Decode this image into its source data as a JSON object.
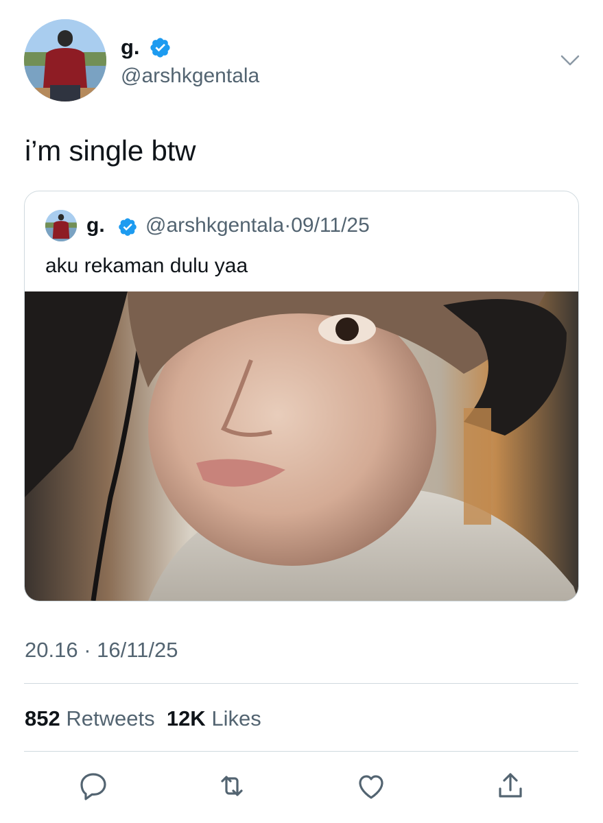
{
  "tweet": {
    "author": {
      "name": "g.",
      "handle": "@arshkgentala",
      "verified": true,
      "avatar": "person-from-behind-landscape"
    },
    "text": "i’m single btw",
    "menu_icon": "chevron-down-icon",
    "quoted": {
      "author_name": "g.",
      "meta": "@arshkgentala·09/11/25",
      "text": "aku rekaman dulu yaa",
      "photo": "selfie-with-headphones"
    },
    "timestamp": "20.16 · 16/11/25",
    "stats": {
      "retweets_count": "852",
      "retweets_label": "Retweets",
      "likes_count": "12K",
      "likes_label": "Likes"
    },
    "actions": [
      "reply-icon",
      "retweet-icon",
      "like-icon",
      "share-icon"
    ]
  },
  "colors": {
    "text": "#0f1419",
    "muted": "#536471",
    "verified": "#1d9bf0",
    "border": "#cfd9de"
  }
}
